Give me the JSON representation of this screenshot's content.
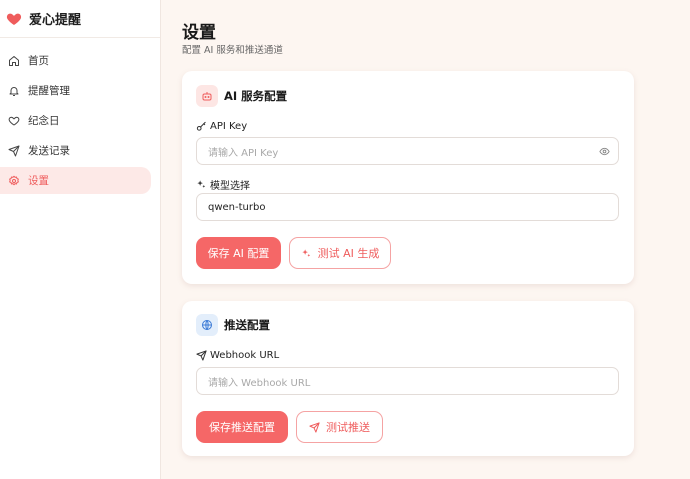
{
  "app": {
    "name": "爱心提醒",
    "brand_color": "#f56767"
  },
  "sidebar": {
    "items": [
      {
        "label": "首页",
        "icon": "home-icon",
        "active": false
      },
      {
        "label": "提醒管理",
        "icon": "bell-icon",
        "active": false
      },
      {
        "label": "纪念日",
        "icon": "heart-icon",
        "active": false
      },
      {
        "label": "发送记录",
        "icon": "send-icon",
        "active": false
      },
      {
        "label": "设置",
        "icon": "gear-icon",
        "active": true
      }
    ]
  },
  "page": {
    "title": "设置",
    "subtitle": "配置 AI 服务和推送通道"
  },
  "ai_card": {
    "title": "AI 服务配置",
    "icon": "robot-icon",
    "api_key": {
      "label": "API Key",
      "placeholder": "请输入 API Key",
      "value": ""
    },
    "model": {
      "label": "模型选择",
      "value": "qwen-turbo"
    },
    "save_label": "保存 AI 配置",
    "test_label": "测试 AI 生成"
  },
  "push_card": {
    "title": "推送配置",
    "icon": "globe-icon",
    "webhook": {
      "label": "Webhook URL",
      "placeholder": "请输入 Webhook URL",
      "value": ""
    },
    "save_label": "保存推送配置",
    "test_label": "测试推送"
  }
}
